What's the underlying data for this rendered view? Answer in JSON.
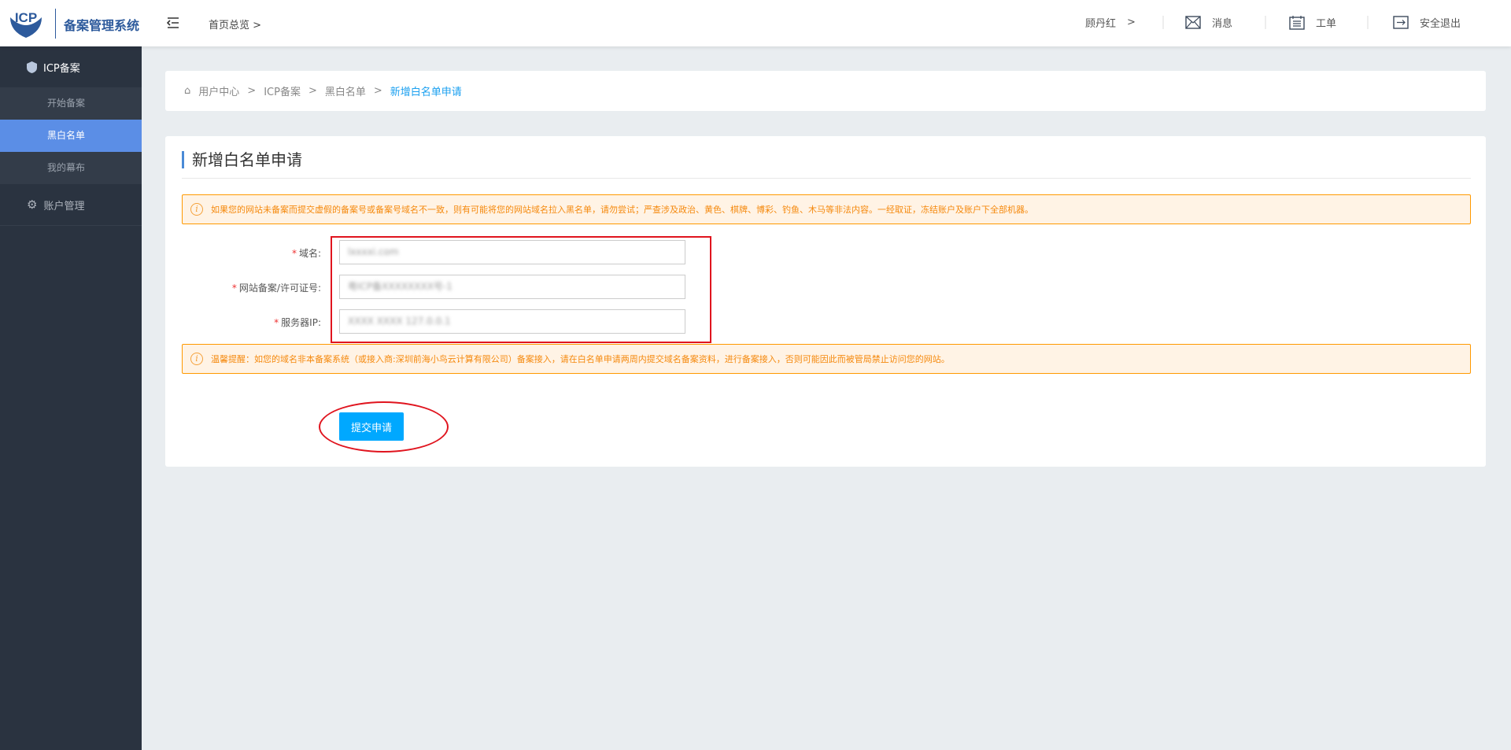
{
  "header": {
    "logo_text": "ICP",
    "system_title": "备案管理系统",
    "home_link": "首页总览",
    "user": "顾丹红",
    "messages": "消息",
    "tickets": "工单",
    "logout": "安全退出"
  },
  "sidebar": {
    "groups": [
      {
        "label": "ICP备案",
        "items": [
          {
            "label": "开始备案"
          },
          {
            "label": "黑白名单"
          },
          {
            "label": "我的幕布"
          }
        ]
      },
      {
        "label": "账户管理"
      }
    ]
  },
  "breadcrumb": [
    "用户中心",
    "ICP备案",
    "黑白名单",
    "新增白名单申请"
  ],
  "form": {
    "title": "新增白名单申请",
    "warning": "如果您的网站未备案而提交虚假的备案号或备案号域名不一致，则有可能将您的网站域名拉入黑名单，请勿尝试；严查涉及政治、黄色、棋牌、博彩、钓鱼、木马等非法内容。一经取证，冻结账户及账户下全部机器。",
    "fields": [
      {
        "label": "域名:",
        "value": "lxxxxi.com"
      },
      {
        "label": "网站备案/许可证号:",
        "value": "粤ICP备XXXXXXXX号-1"
      },
      {
        "label": "服务器IP:",
        "value": "XXXX XXXX 127.0.0.1"
      }
    ],
    "notice": "温馨提醒：如您的域名非本备案系统（或接入商:深圳前海小鸟云计算有限公司）备案接入，请在白名单申请两周内提交域名备案资料，进行备案接入，否则可能因此而被管局禁止访问您的网站。",
    "submit": "提交申请"
  }
}
